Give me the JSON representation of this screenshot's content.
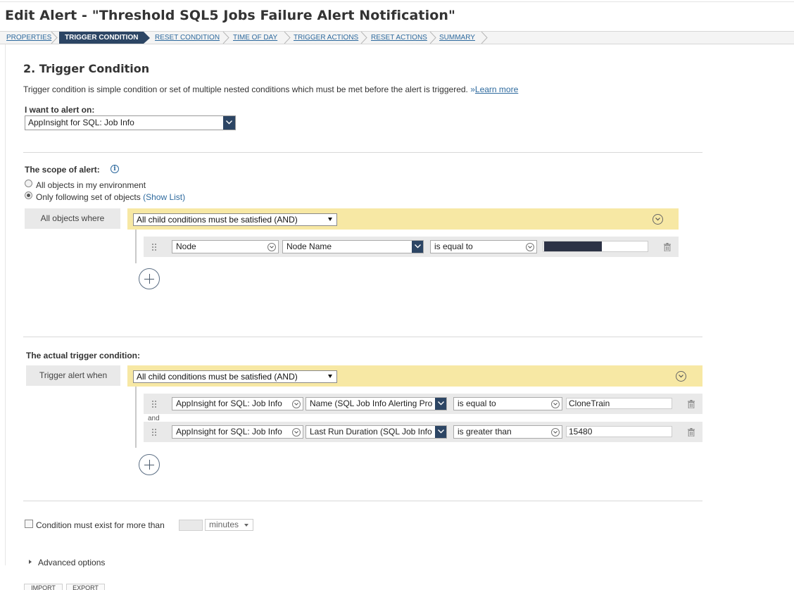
{
  "page": {
    "title": "Edit Alert - \"Threshold SQL5 Jobs Failure Alert Notification\""
  },
  "wizard": {
    "steps": [
      "PROPERTIES",
      "TRIGGER CONDITION",
      "RESET CONDITION",
      "TIME OF DAY",
      "TRIGGER ACTIONS",
      "RESET ACTIONS",
      "SUMMARY"
    ],
    "active_step": "TRIGGER CONDITION"
  },
  "section": {
    "title": "2. Trigger Condition",
    "description": "Trigger condition is simple condition or set of multiple nested conditions which must be met before the alert is triggered.",
    "learn_more_prefix": "»",
    "learn_more": "Learn more"
  },
  "alert_on": {
    "label": "I want to alert on:",
    "value": "AppInsight for SQL: Job Info"
  },
  "scope": {
    "label": "The scope of alert:",
    "options": [
      {
        "label": "All objects in my environment",
        "selected": false
      },
      {
        "label": "Only following set of objects",
        "selected": true
      }
    ],
    "show_list": "(Show List)",
    "where_label": "All objects where",
    "logic": "All child conditions must be satisfied (AND)",
    "condition": {
      "object": "Node",
      "field": "Node Name",
      "operator": "is equal to",
      "value_masked": true
    }
  },
  "trigger": {
    "label": "The actual trigger condition:",
    "when_label": "Trigger alert when",
    "logic": "All child conditions must be satisfied (AND)",
    "joiner": "and",
    "conditions": [
      {
        "object": "AppInsight for SQL: Job Info",
        "field": "Name (SQL Job Info Alerting Pro",
        "operator": "is equal to",
        "value": "CloneTrain"
      },
      {
        "object": "AppInsight for SQL: Job Info",
        "field": "Last Run Duration (SQL Job Info",
        "operator": "is greater than",
        "value": "15480"
      }
    ]
  },
  "duration": {
    "label": "Condition must exist for more than",
    "value": "",
    "unit": "minutes"
  },
  "advanced": {
    "label": "Advanced options"
  },
  "footer": {
    "buttons": [
      "IMPORT",
      "EXPORT"
    ]
  },
  "colors": {
    "accent": "#2c4564",
    "link": "#2e6a9e",
    "and_band": "#f7e8a4",
    "row_bg": "#e9e9e9"
  }
}
